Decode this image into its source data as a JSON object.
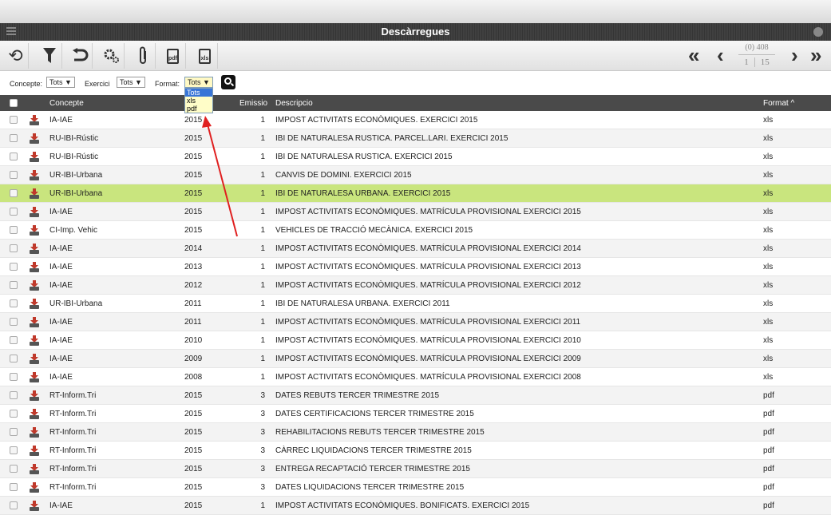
{
  "window": {
    "title": "Descàrregues"
  },
  "toolbar": {
    "pdf_label": "pdf",
    "xls_label": "xls"
  },
  "pager": {
    "count": "(0) 408",
    "current": "1",
    "total": "15"
  },
  "filters": {
    "concepte_label": "Concepte:",
    "concepte_value": "Tots",
    "exercici_label": "Exercici",
    "exercici_value": "Tots",
    "format_label": "Format:",
    "format_value": "Tots",
    "format_options": [
      "Tots",
      "xls",
      "pdf"
    ]
  },
  "table": {
    "headers": {
      "concepte": "Concepte",
      "exercici": "E",
      "emissio": "Emissio",
      "descripcio": "Descripcio",
      "format": "Format ^"
    },
    "rows": [
      {
        "concepte": "IA-IAE",
        "exercici": "2015",
        "emissio": "1",
        "descripcio": "IMPOST ACTIVITATS ECONÒMIQUES. EXERCICI 2015",
        "format": "xls"
      },
      {
        "concepte": "RU-IBI-Rústic",
        "exercici": "2015",
        "emissio": "1",
        "descripcio": "IBI DE NATURALESA RUSTICA. PARCEL.LARI. EXERCICI 2015",
        "format": "xls"
      },
      {
        "concepte": "RU-IBI-Rústic",
        "exercici": "2015",
        "emissio": "1",
        "descripcio": "IBI DE NATURALESA RUSTICA. EXERCICI 2015",
        "format": "xls"
      },
      {
        "concepte": "UR-IBI-Urbana",
        "exercici": "2015",
        "emissio": "1",
        "descripcio": "CANVIS DE DOMINI. EXERCICI 2015",
        "format": "xls"
      },
      {
        "concepte": "UR-IBI-Urbana",
        "exercici": "2015",
        "emissio": "1",
        "descripcio": "IBI DE NATURALESA URBANA. EXERCICI 2015",
        "format": "xls"
      },
      {
        "concepte": "IA-IAE",
        "exercici": "2015",
        "emissio": "1",
        "descripcio": "IMPOST ACTIVITATS ECONÒMIQUES. MATRÍCULA PROVISIONAL EXERCICI 2015",
        "format": "xls"
      },
      {
        "concepte": "CI-Imp. Vehic",
        "exercici": "2015",
        "emissio": "1",
        "descripcio": "VEHICLES DE TRACCIÓ MECÀNICA. EXERCICI 2015",
        "format": "xls"
      },
      {
        "concepte": "IA-IAE",
        "exercici": "2014",
        "emissio": "1",
        "descripcio": "IMPOST ACTIVITATS ECONÒMIQUES. MATRÍCULA PROVISIONAL EXERCICI 2014",
        "format": "xls"
      },
      {
        "concepte": "IA-IAE",
        "exercici": "2013",
        "emissio": "1",
        "descripcio": "IMPOST ACTIVITATS ECONÒMIQUES. MATRÍCULA PROVISIONAL EXERCICI 2013",
        "format": "xls"
      },
      {
        "concepte": "IA-IAE",
        "exercici": "2012",
        "emissio": "1",
        "descripcio": "IMPOST ACTIVITATS ECONÒMIQUES. MATRÍCULA PROVISIONAL EXERCICI 2012",
        "format": "xls"
      },
      {
        "concepte": "UR-IBI-Urbana",
        "exercici": "2011",
        "emissio": "1",
        "descripcio": "IBI DE NATURALESA URBANA. EXERCICI 2011",
        "format": "xls"
      },
      {
        "concepte": "IA-IAE",
        "exercici": "2011",
        "emissio": "1",
        "descripcio": "IMPOST ACTIVITATS ECONÒMIQUES. MATRÍCULA PROVISIONAL EXERCICI 2011",
        "format": "xls"
      },
      {
        "concepte": "IA-IAE",
        "exercici": "2010",
        "emissio": "1",
        "descripcio": "IMPOST ACTIVITATS ECONÒMIQUES. MATRÍCULA PROVISIONAL EXERCICI 2010",
        "format": "xls"
      },
      {
        "concepte": "IA-IAE",
        "exercici": "2009",
        "emissio": "1",
        "descripcio": "IMPOST ACTIVITATS ECONÒMIQUES. MATRÍCULA PROVISIONAL EXERCICI 2009",
        "format": "xls"
      },
      {
        "concepte": "IA-IAE",
        "exercici": "2008",
        "emissio": "1",
        "descripcio": "IMPOST ACTIVITATS ECONÒMIQUES. MATRÍCULA PROVISIONAL EXERCICI 2008",
        "format": "xls"
      },
      {
        "concepte": "RT-Inform.Tri",
        "exercici": "2015",
        "emissio": "3",
        "descripcio": "DATES REBUTS TERCER TRIMESTRE 2015",
        "format": "pdf"
      },
      {
        "concepte": "RT-Inform.Tri",
        "exercici": "2015",
        "emissio": "3",
        "descripcio": "DATES CERTIFICACIONS TERCER TRIMESTRE 2015",
        "format": "pdf"
      },
      {
        "concepte": "RT-Inform.Tri",
        "exercici": "2015",
        "emissio": "3",
        "descripcio": "REHABILITACIONS REBUTS TERCER TRIMESTRE 2015",
        "format": "pdf"
      },
      {
        "concepte": "RT-Inform.Tri",
        "exercici": "2015",
        "emissio": "3",
        "descripcio": "CÀRREC LIQUIDACIONS TERCER TRIMESTRE 2015",
        "format": "pdf"
      },
      {
        "concepte": "RT-Inform.Tri",
        "exercici": "2015",
        "emissio": "3",
        "descripcio": "ENTREGA RECAPTACIÓ TERCER TRIMESTRE 2015",
        "format": "pdf"
      },
      {
        "concepte": "RT-Inform.Tri",
        "exercici": "2015",
        "emissio": "3",
        "descripcio": "DATES LIQUIDACIONS TERCER TRIMESTRE 2015",
        "format": "pdf"
      },
      {
        "concepte": "IA-IAE",
        "exercici": "2015",
        "emissio": "1",
        "descripcio": "IMPOST ACTIVITATS ECONÒMIQUES. BONIFICATS. EXERCICI 2015",
        "format": "pdf"
      }
    ],
    "highlighted_row": 4,
    "highlight_color": "#c9e57e"
  },
  "annotation_color": "#e02020"
}
